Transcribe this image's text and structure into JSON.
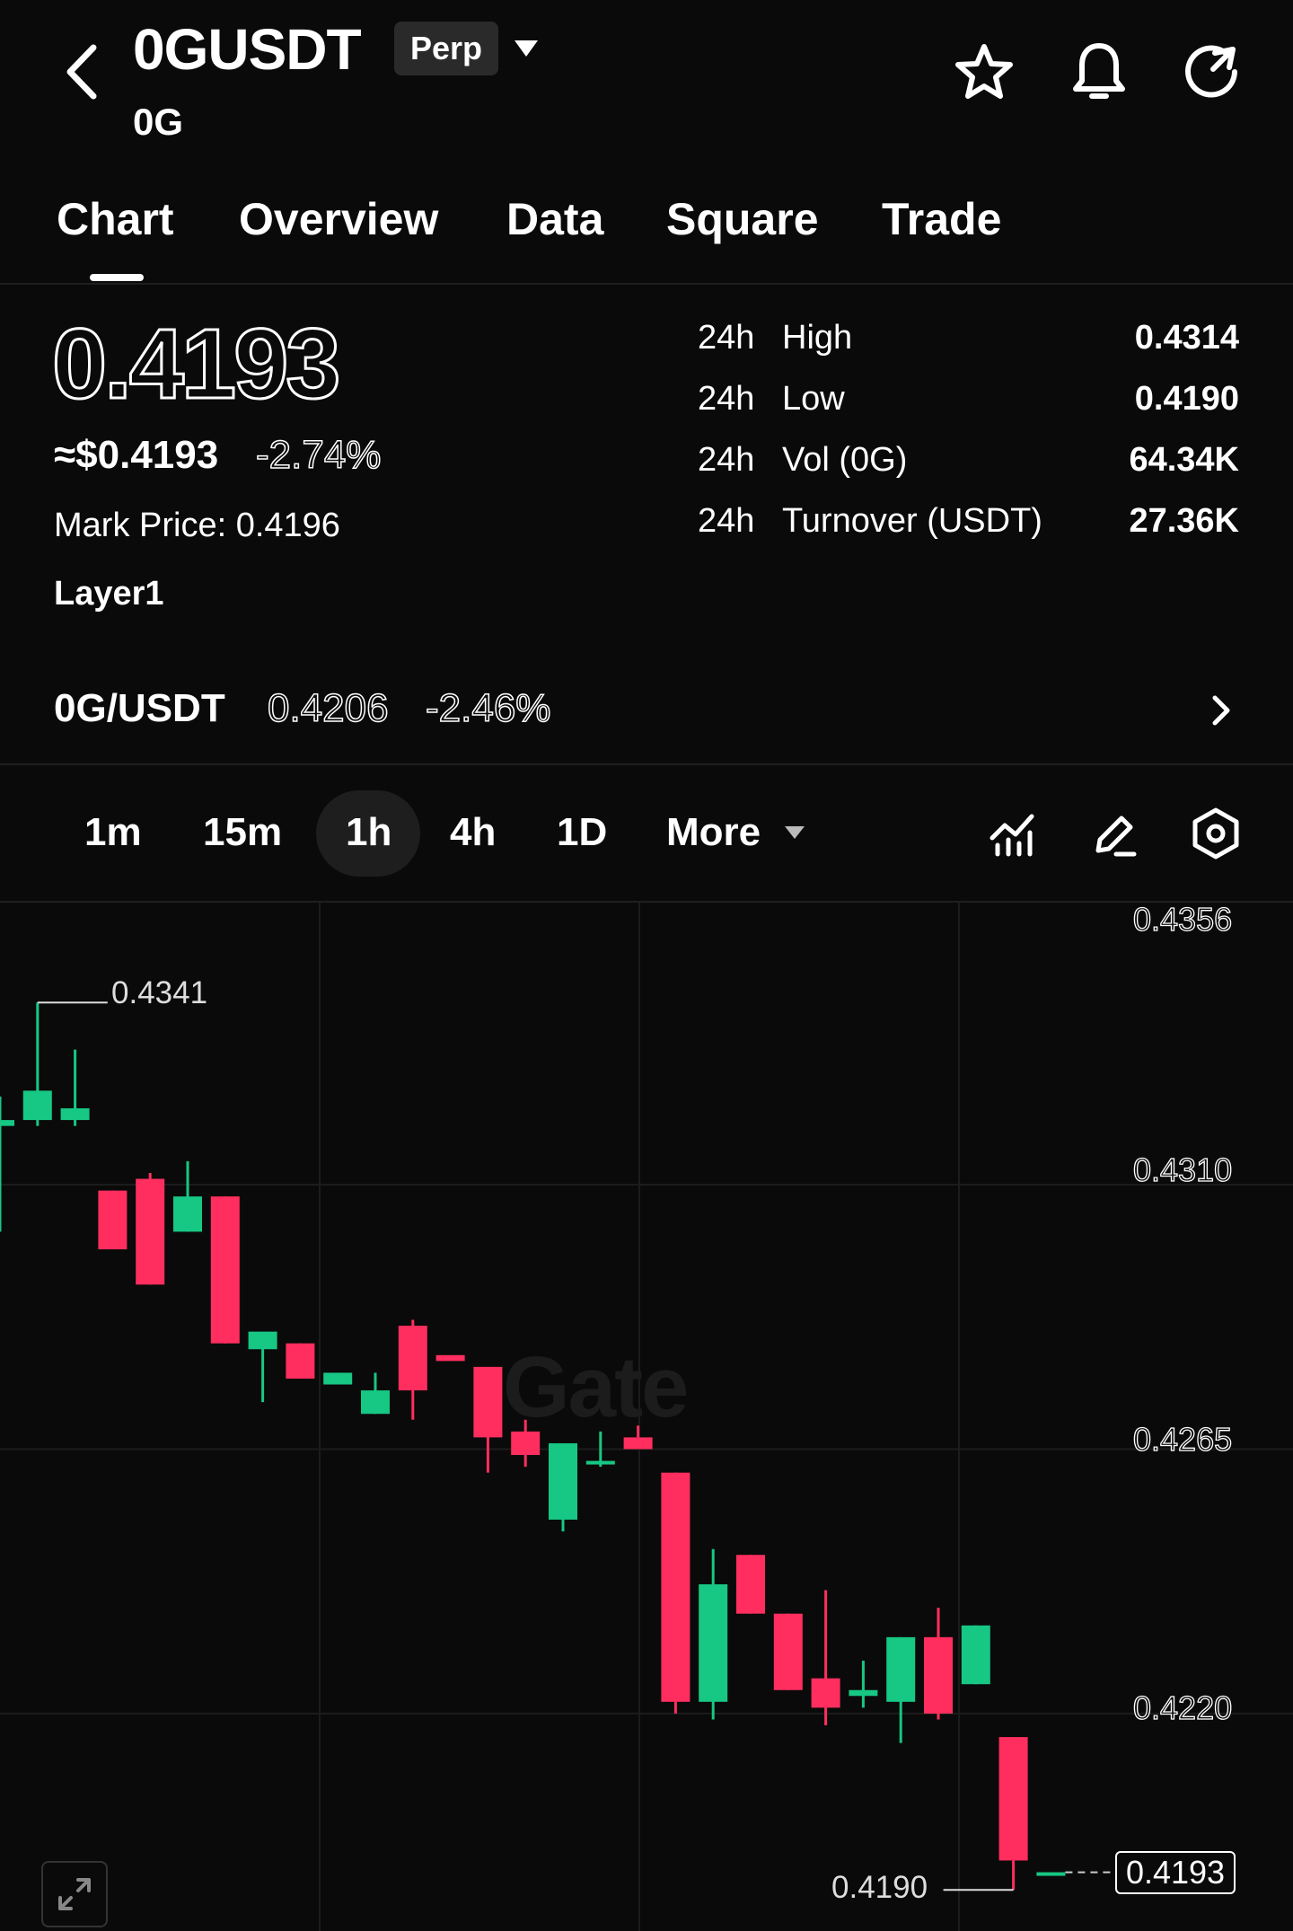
{
  "header": {
    "symbol": "0GUSDT",
    "badge": "Perp",
    "subtitle": "0G",
    "icons": [
      "back-arrow-icon",
      "star-icon",
      "bell-icon",
      "share-icon"
    ]
  },
  "tabs": [
    "Chart",
    "Overview",
    "Data",
    "Square",
    "Trade"
  ],
  "active_tab": "Chart",
  "price": {
    "last": "0.4193",
    "usd": "≈$0.4193",
    "change": "-2.74%",
    "mark_price": "Mark Price: 0.4196",
    "category": "Layer1"
  },
  "stats": [
    {
      "period": "24h",
      "label": "High",
      "value": "0.4314"
    },
    {
      "period": "24h",
      "label": "Low",
      "value": "0.4190"
    },
    {
      "period": "24h",
      "label": "Vol (0G)",
      "value": "64.34K"
    },
    {
      "period": "24h",
      "label": "Turnover (USDT)",
      "value": "27.36K"
    }
  ],
  "spot": {
    "pair": "0G/USDT",
    "price": "0.4206",
    "change": "-2.46%"
  },
  "timeframes": [
    "1m",
    "15m",
    "1h",
    "4h",
    "1D",
    "More"
  ],
  "active_timeframe": "1h",
  "colors": {
    "up": "#17c784",
    "down": "#ff2e5f",
    "background": "#0a0a0a"
  },
  "chart_data": {
    "type": "candlestick",
    "interval": "1h",
    "watermark": "Gate",
    "y_ticks": [
      "0.4356",
      "0.4310",
      "0.4265",
      "0.4220"
    ],
    "ylim": [
      0.4183,
      0.4358
    ],
    "high_marker": "0.4341",
    "low_marker": "0.4190",
    "last_price_label": "0.4193",
    "candles": [
      {
        "o": 0.432,
        "h": 0.4325,
        "l": 0.4302,
        "c": 0.4321
      },
      {
        "o": 0.4321,
        "h": 0.4341,
        "l": 0.432,
        "c": 0.4326
      },
      {
        "o": 0.4321,
        "h": 0.4333,
        "l": 0.432,
        "c": 0.4323
      },
      {
        "o": 0.4309,
        "h": 0.4309,
        "l": 0.4299,
        "c": 0.4299
      },
      {
        "o": 0.4311,
        "h": 0.4312,
        "l": 0.4293,
        "c": 0.4293
      },
      {
        "o": 0.4302,
        "h": 0.4314,
        "l": 0.4302,
        "c": 0.4308
      },
      {
        "o": 0.4308,
        "h": 0.4308,
        "l": 0.4283,
        "c": 0.4283
      },
      {
        "o": 0.4282,
        "h": 0.4284,
        "l": 0.4273,
        "c": 0.4285
      },
      {
        "o": 0.4283,
        "h": 0.4283,
        "l": 0.4277,
        "c": 0.4277
      },
      {
        "o": 0.4276,
        "h": 0.4278,
        "l": 0.4276,
        "c": 0.4278
      },
      {
        "o": 0.4271,
        "h": 0.4278,
        "l": 0.4271,
        "c": 0.4275
      },
      {
        "o": 0.4286,
        "h": 0.4287,
        "l": 0.427,
        "c": 0.4275
      },
      {
        "o": 0.4281,
        "h": 0.4281,
        "l": 0.4281,
        "c": 0.428
      },
      {
        "o": 0.4279,
        "h": 0.4279,
        "l": 0.4261,
        "c": 0.4267
      },
      {
        "o": 0.4268,
        "h": 0.427,
        "l": 0.4262,
        "c": 0.4264
      },
      {
        "o": 0.4253,
        "h": 0.4266,
        "l": 0.4251,
        "c": 0.4266
      },
      {
        "o": 0.4263,
        "h": 0.4268,
        "l": 0.4262,
        "c": 0.4263
      },
      {
        "o": 0.4267,
        "h": 0.4269,
        "l": 0.4267,
        "c": 0.4265
      },
      {
        "o": 0.4261,
        "h": 0.4261,
        "l": 0.422,
        "c": 0.4222
      },
      {
        "o": 0.4222,
        "h": 0.4248,
        "l": 0.4219,
        "c": 0.4242
      },
      {
        "o": 0.4247,
        "h": 0.4247,
        "l": 0.4237,
        "c": 0.4237
      },
      {
        "o": 0.4237,
        "h": 0.4237,
        "l": 0.4224,
        "c": 0.4224
      },
      {
        "o": 0.4226,
        "h": 0.4241,
        "l": 0.4218,
        "c": 0.4221
      },
      {
        "o": 0.4223,
        "h": 0.4229,
        "l": 0.4221,
        "c": 0.4224
      },
      {
        "o": 0.4222,
        "h": 0.4233,
        "l": 0.4215,
        "c": 0.4233
      },
      {
        "o": 0.4233,
        "h": 0.4238,
        "l": 0.4219,
        "c": 0.422
      },
      {
        "o": 0.4225,
        "h": 0.4235,
        "l": 0.4225,
        "c": 0.4235
      },
      {
        "o": 0.4216,
        "h": 0.4216,
        "l": 0.419,
        "c": 0.4195
      },
      {
        "o": 0.4193,
        "h": 0.4193,
        "l": 0.4193,
        "c": 0.4193
      }
    ]
  }
}
